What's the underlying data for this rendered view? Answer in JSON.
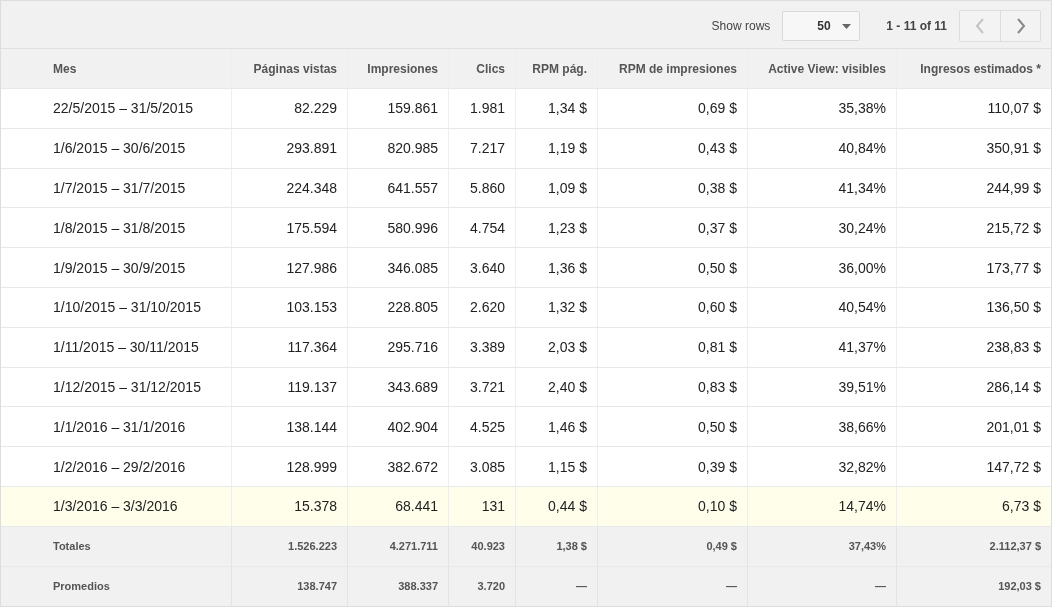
{
  "toolbar": {
    "show_rows_label": "Show rows",
    "rows_select": {
      "value": "50"
    },
    "range": "1 - 11 of 11",
    "prev_disabled": true,
    "next_disabled": false
  },
  "table": {
    "columns": [
      "Mes",
      "Páginas vistas",
      "Impresiones",
      "Clics",
      "RPM pág.",
      "RPM de impresiones",
      "Active View: visibles",
      "Ingresos estimados *"
    ],
    "rows": [
      {
        "highlighted": false,
        "cells": [
          "22/5/2015 – 31/5/2015",
          "82.229",
          "159.861",
          "1.981",
          "1,34 $",
          "0,69 $",
          "35,38%",
          "110,07 $"
        ]
      },
      {
        "highlighted": false,
        "cells": [
          "1/6/2015 – 30/6/2015",
          "293.891",
          "820.985",
          "7.217",
          "1,19 $",
          "0,43 $",
          "40,84%",
          "350,91 $"
        ]
      },
      {
        "highlighted": false,
        "cells": [
          "1/7/2015 – 31/7/2015",
          "224.348",
          "641.557",
          "5.860",
          "1,09 $",
          "0,38 $",
          "41,34%",
          "244,99 $"
        ]
      },
      {
        "highlighted": false,
        "cells": [
          "1/8/2015 – 31/8/2015",
          "175.594",
          "580.996",
          "4.754",
          "1,23 $",
          "0,37 $",
          "30,24%",
          "215,72 $"
        ]
      },
      {
        "highlighted": false,
        "cells": [
          "1/9/2015 – 30/9/2015",
          "127.986",
          "346.085",
          "3.640",
          "1,36 $",
          "0,50 $",
          "36,00%",
          "173,77 $"
        ]
      },
      {
        "highlighted": false,
        "cells": [
          "1/10/2015 – 31/10/2015",
          "103.153",
          "228.805",
          "2.620",
          "1,32 $",
          "0,60 $",
          "40,54%",
          "136,50 $"
        ]
      },
      {
        "highlighted": false,
        "cells": [
          "1/11/2015 – 30/11/2015",
          "117.364",
          "295.716",
          "3.389",
          "2,03 $",
          "0,81 $",
          "41,37%",
          "238,83 $"
        ]
      },
      {
        "highlighted": false,
        "cells": [
          "1/12/2015 – 31/12/2015",
          "119.137",
          "343.689",
          "3.721",
          "2,40 $",
          "0,83 $",
          "39,51%",
          "286,14 $"
        ]
      },
      {
        "highlighted": false,
        "cells": [
          "1/1/2016 – 31/1/2016",
          "138.144",
          "402.904",
          "4.525",
          "1,46 $",
          "0,50 $",
          "38,66%",
          "201,01 $"
        ]
      },
      {
        "highlighted": false,
        "cells": [
          "1/2/2016 – 29/2/2016",
          "128.999",
          "382.672",
          "3.085",
          "1,15 $",
          "0,39 $",
          "32,82%",
          "147,72 $"
        ]
      },
      {
        "highlighted": true,
        "cells": [
          "1/3/2016 – 3/3/2016",
          "15.378",
          "68.441",
          "131",
          "0,44 $",
          "0,10 $",
          "14,74%",
          "6,73 $"
        ]
      }
    ],
    "summary_rows": [
      {
        "cells": [
          "Totales",
          "1.526.223",
          "4.271.711",
          "40.923",
          "1,38 $",
          "0,49 $",
          "37,43%",
          "2.112,37 $"
        ]
      },
      {
        "cells": [
          "Promedios",
          "138.747",
          "388.337",
          "3.720",
          "—",
          "—",
          "—",
          "192,03 $"
        ]
      }
    ]
  }
}
